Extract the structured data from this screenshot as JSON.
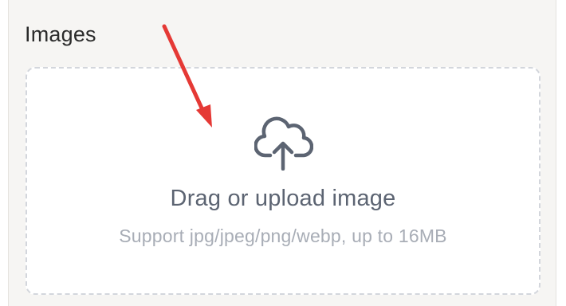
{
  "section": {
    "title": "Images"
  },
  "dropzone": {
    "icon": "cloud-upload-icon",
    "primary_text": "Drag or upload image",
    "secondary_text": "Support jpg/jpeg/png/webp, up to 16MB"
  },
  "colors": {
    "panel_background": "#f6f5f3",
    "dropzone_border": "#d3d6dc",
    "icon": "#5c6472",
    "annotation_arrow": "#e53935"
  }
}
